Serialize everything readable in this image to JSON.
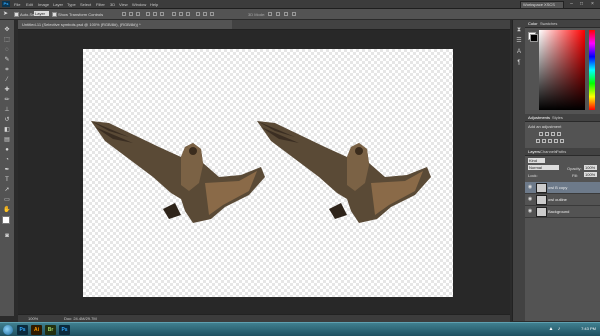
{
  "app": {
    "logo": "Ps",
    "menu": [
      "File",
      "Edit",
      "Image",
      "Layer",
      "Type",
      "Select",
      "Filter",
      "3D",
      "View",
      "Window",
      "Help"
    ],
    "workspace": "Workspace XSCS",
    "window_controls": {
      "minimize": "–",
      "maximize": "□",
      "close": "×"
    }
  },
  "options_bar": {
    "auto_select_label": "Auto-Select:",
    "auto_select_target": "Layer",
    "show_transform_label": "Show Transform Controls",
    "mode_3d_label": "3D Mode:"
  },
  "document": {
    "tab_title": "Untitled-11 (Selective symbols.psd @ 100% (RGB/8#), (RGB/8#)) *"
  },
  "status": {
    "zoom": "100%",
    "doc_size": "Doc: 24.4M/29.7M"
  },
  "panels": {
    "color_tabs": [
      "Color",
      "Swatches"
    ],
    "adjust_tabs": [
      "Adjustments",
      "Styles"
    ],
    "adjust_label": "Add an adjustment",
    "layers_tabs": [
      "Layers",
      "Channels",
      "Paths"
    ],
    "layers_filter": "Kind",
    "blend_mode": "Normal",
    "opacity_label": "Opacity:",
    "opacity_value": "100%",
    "lock_label": "Lock:",
    "fill_label": "Fill:",
    "fill_value": "100%",
    "layers": [
      {
        "name": "owl B copy",
        "selected": true
      },
      {
        "name": "owl outline",
        "selected": false
      },
      {
        "name": "Background",
        "selected": false
      }
    ]
  },
  "taskbar": {
    "apps": [
      {
        "label": "Ps",
        "color": "#31a8ff",
        "bg": "#0b2a3c"
      },
      {
        "label": "Ai",
        "color": "#ff9a00",
        "bg": "#2e1a00"
      },
      {
        "label": "Br",
        "color": "#a3d46a",
        "bg": "#223010"
      },
      {
        "label": "Ps",
        "color": "#31a8ff",
        "bg": "#0b2a3c"
      }
    ],
    "clock": "7:43 PM"
  }
}
